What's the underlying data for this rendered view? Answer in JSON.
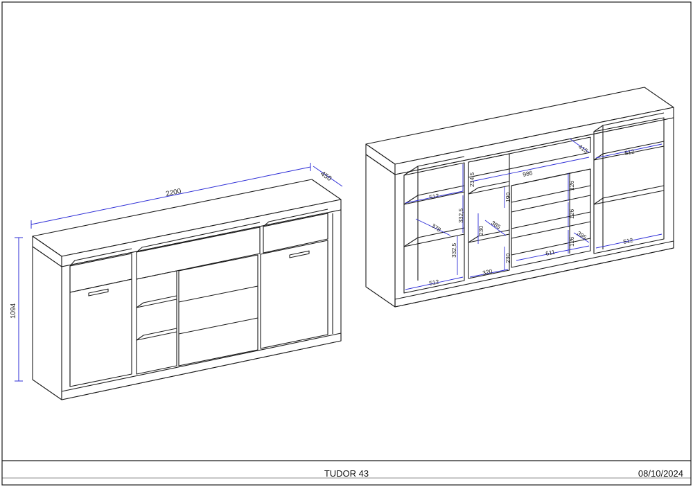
{
  "title_block": {
    "drawing_title": "TUDOR 43",
    "date": "08/10/2024"
  },
  "colors": {
    "line": "#1a1a1a",
    "dimension": "#2b2bd6"
  },
  "front_view": {
    "width": "2200",
    "depth": "450",
    "height": "1094"
  },
  "back_view": {
    "top_center_width": "986",
    "depth_top": "415",
    "right_shelf_top": "512",
    "left_shelf_top": "512",
    "left_gap": "234,5",
    "left_gap_1": "332,5",
    "left_gap_2": "332,5",
    "left_depth": "378",
    "left_shelf_bottom": "512",
    "mid_gap_top": "190",
    "mid_gap_1": "230",
    "mid_gap_2": "230",
    "mid_depth": "385",
    "mid_width": "320",
    "drawer_h1": "126",
    "drawer_h2": "126",
    "drawer_h3": "126",
    "drawer_depth": "395",
    "drawer_width": "611",
    "right_shelf_bottom": "512"
  }
}
